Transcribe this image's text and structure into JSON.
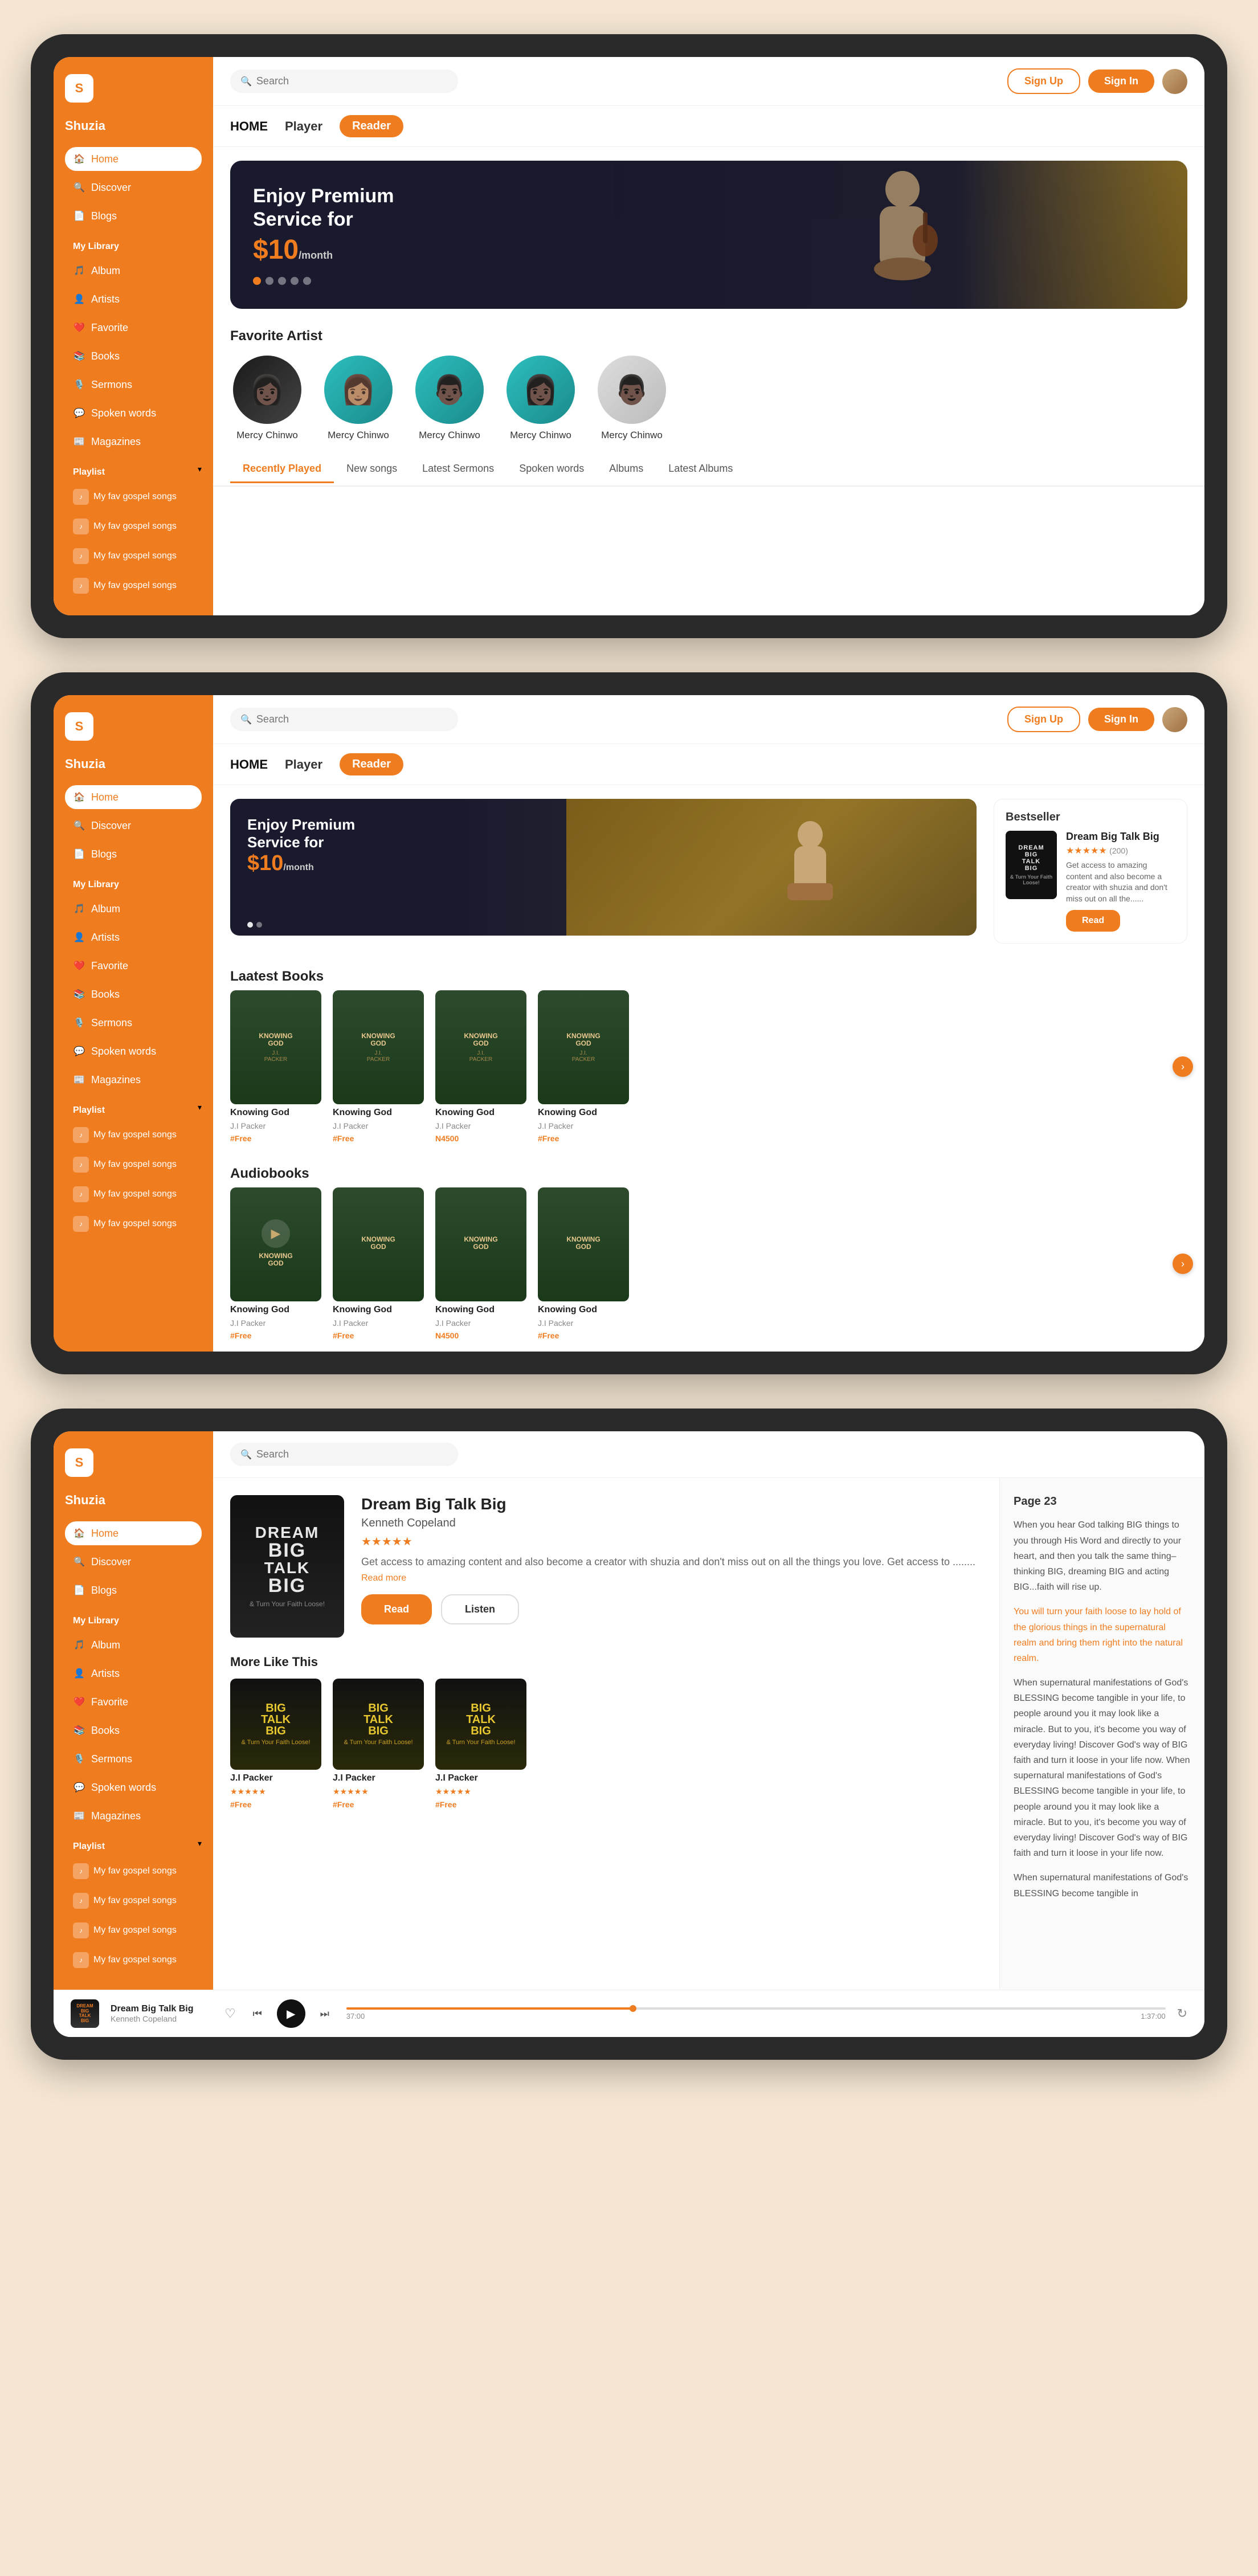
{
  "app": {
    "logo": "S",
    "brand": "Shuzia",
    "search_placeholder": "Search"
  },
  "topbar": {
    "signup_label": "Sign Up",
    "signin_label": "Sign In"
  },
  "nav": {
    "home_label": "HOME",
    "player_label": "Player",
    "reader_label": "Reader",
    "tabs": [
      "HOME",
      "Player",
      "Reader"
    ]
  },
  "sidebar": {
    "nav_items": [
      {
        "label": "Home",
        "icon": "🏠",
        "active": true
      },
      {
        "label": "Discover",
        "icon": "🔍",
        "active": false
      },
      {
        "label": "Blogs",
        "icon": "📄",
        "active": false
      }
    ],
    "library_label": "My Library",
    "library_items": [
      {
        "label": "Album",
        "icon": "🎵"
      },
      {
        "label": "Artists",
        "icon": "👤"
      },
      {
        "label": "Favorite",
        "icon": "❤️"
      },
      {
        "label": "Books",
        "icon": "📚"
      },
      {
        "label": "Sermons",
        "icon": "🎙️"
      },
      {
        "label": "Spoken words",
        "icon": "💬"
      },
      {
        "label": "Magazines",
        "icon": "📰"
      }
    ],
    "playlist_label": "Playlist",
    "playlist_items": [
      {
        "label": "My fav gospel songs"
      },
      {
        "label": "My fav gospel songs"
      },
      {
        "label": "My fav gospel songs"
      },
      {
        "label": "My fav gospel songs"
      }
    ]
  },
  "screen1": {
    "hero": {
      "title": "Enjoy Premium\nService for",
      "price_prefix": "$",
      "price": "10",
      "price_suffix": "/month"
    },
    "dots": [
      true,
      false,
      false,
      false,
      false
    ],
    "favorite_artists_label": "Favorite Artist",
    "artists": [
      {
        "name": "Mercy Chinwo"
      },
      {
        "name": "Mercy Chinwo"
      },
      {
        "name": "Mercy Chinwo"
      },
      {
        "name": "Mercy Chinwo"
      },
      {
        "name": "Mercy Chinwo"
      }
    ],
    "tabs": [
      "Recently Played",
      "New songs",
      "Latest Sermons",
      "Spoken words",
      "Albums",
      "Latest Albums"
    ]
  },
  "screen2": {
    "promo": {
      "title": "Enjoy Premium\nService for",
      "price_prefix": "$",
      "price": "10",
      "price_suffix": "/month"
    },
    "bestseller_label": "Bestseller",
    "bestseller": {
      "title": "Dream Big Talk Big",
      "rating": "★★★★★",
      "rating_count": "(200)",
      "desc": "Get access to amazing content and also become a creator with shuzia and don't miss out on all the......",
      "read_label": "Read"
    },
    "latest_books_label": "Laatest Books",
    "audiobooks_label": "Audiobooks",
    "books": [
      {
        "title": "Knowing God",
        "author": "J.I Packer",
        "price": "#Free",
        "free": true
      },
      {
        "title": "Knowing God",
        "author": "J.I Packer",
        "price": "#Free",
        "free": true
      },
      {
        "title": "Knowing God",
        "author": "J.I Packer",
        "price": "N4500",
        "free": false
      },
      {
        "title": "Knowing God",
        "author": "J.I Packer",
        "price": "#Free",
        "free": true
      }
    ],
    "audiobooks": [
      {
        "title": "Knowing God",
        "author": "J.I Packer",
        "price": "#Free",
        "free": true
      },
      {
        "title": "Knowing God",
        "author": "J.I Packer",
        "price": "#Free",
        "free": true
      },
      {
        "title": "Knowing God",
        "author": "J.I Packer",
        "price": "N4500",
        "free": false
      },
      {
        "title": "Knowing God",
        "author": "J.I Packer",
        "price": "#Free",
        "free": true
      }
    ]
  },
  "screen3": {
    "book": {
      "title": "Dream Big Talk Big",
      "author": "Kenneth Copeland",
      "rating": "★★★★★",
      "desc": "Get access to amazing content and also become a creator with shuzia and don't miss out on all the things you love. Get access to ........",
      "read_more": "Read more",
      "read_label": "Read",
      "listen_label": "Listen"
    },
    "reader": {
      "page": "Page 23",
      "text1": "When you hear God talking BIG things to you through His Word and directly to your heart, and then you talk the same thing–thinking BIG, dreaming BIG and acting BIG...faith will rise up.",
      "text_highlight": "You will turn your faith loose to lay hold of the glorious things in the supernatural realm and bring them right into the natural realm.",
      "text2": "When supernatural manifestations of God's BLESSING become tangible in your life, to people around you it may look like a miracle. But to you, it's become you way of everyday living! Discover God's way of BIG faith and turn it loose in your life now. When supernatural manifestations of God's BLESSING become tangible in your life, to people around you it may look like a miracle. But to you, it's become you way of everyday living! Discover God's way of BIG faith and turn it loose in your life now.",
      "text3": "When supernatural manifestations of God's BLESSING become tangible in"
    },
    "more_like_label": "More Like This",
    "more_like": [
      {
        "title": "Big Talk Big",
        "author": "J.I Packer",
        "rating": "★★★★★",
        "price": "#Free"
      },
      {
        "title": "Big Talk Big",
        "author": "J.I Packer",
        "rating": "★★★★★",
        "price": "#Free"
      },
      {
        "title": "Big Talk Big",
        "author": "J.I Packer",
        "rating": "★★★★★",
        "price": "#Free"
      }
    ],
    "player": {
      "cover_book": "Dream Big Talk Big",
      "title": "Dream Big Talk Big",
      "artist": "Kenneth Copeland",
      "time_current": "37:00",
      "time_total": "1:37:00",
      "progress": 35
    }
  }
}
